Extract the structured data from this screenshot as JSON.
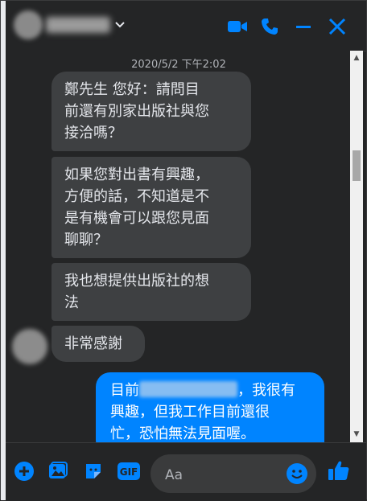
{
  "header": {
    "chevron_icon": "chevron-down-icon",
    "actions": [
      "video-call-icon",
      "phone-call-icon",
      "minimize-icon",
      "close-icon"
    ],
    "accent_color": "#0084ff"
  },
  "chat": {
    "timestamp": "2020/5/2 下午2:02",
    "incoming": [
      {
        "lines": [
          "鄭先生  您好：請問目",
          "前還有別家出版社與您",
          "接洽嗎？"
        ]
      },
      {
        "lines": [
          "如果您對出書有興趣，",
          "方便的話，不知道是不",
          "是有機會可以跟您見面",
          "聊聊？"
        ]
      },
      {
        "lines": [
          "我也想提供出版社的想",
          "法"
        ]
      },
      {
        "lines": [
          "非常感謝"
        ]
      }
    ],
    "outgoing": {
      "line1_prefix": "目前",
      "line1_suffix": "，我很有",
      "line2": "興趣，但我工作目前還很",
      "line3": "忙，恐怕無法見面喔。"
    }
  },
  "footer": {
    "icons": [
      "add-icon",
      "image-icon",
      "sticker-icon",
      "gif-icon"
    ],
    "gif_label": "GIF",
    "input_placeholder": "Aa",
    "emoji_icon": "emoji-icon",
    "like_icon": "thumbs-up-icon"
  }
}
